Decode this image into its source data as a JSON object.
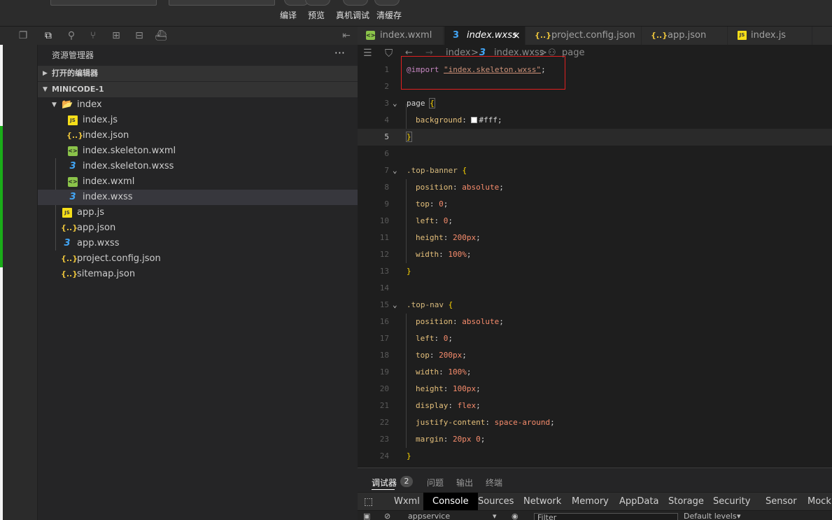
{
  "toolbar": {
    "compile": "编译",
    "preview": "预览",
    "device_debug": "真机调试",
    "clear_cache": "清缓存"
  },
  "activity_icons": [
    "window-icon",
    "files-icon",
    "search-icon",
    "git-branch-icon",
    "extensions-icon",
    "storage-icon",
    "docker-icon"
  ],
  "explorer": {
    "title": "资源管理器",
    "more": "···",
    "open_editors": "打开的编辑器",
    "project": "MINICODE-1",
    "tree": [
      {
        "label": "index",
        "type": "folder",
        "depth": 1
      },
      {
        "label": "index.js",
        "type": "js",
        "depth": 2
      },
      {
        "label": "index.json",
        "type": "json",
        "depth": 2
      },
      {
        "label": "index.skeleton.wxml",
        "type": "wxml",
        "depth": 2
      },
      {
        "label": "index.skeleton.wxss",
        "type": "wxss",
        "depth": 2
      },
      {
        "label": "index.wxml",
        "type": "wxml",
        "depth": 2
      },
      {
        "label": "index.wxss",
        "type": "wxss",
        "depth": 2,
        "selected": true
      },
      {
        "label": "app.js",
        "type": "js",
        "depth": 1
      },
      {
        "label": "app.json",
        "type": "json",
        "depth": 1
      },
      {
        "label": "app.wxss",
        "type": "wxss",
        "depth": 1
      },
      {
        "label": "project.config.json",
        "type": "json",
        "depth": 1
      },
      {
        "label": "sitemap.json",
        "type": "json",
        "depth": 1
      }
    ]
  },
  "tabs": [
    {
      "label": "index.wxml",
      "type": "wxml"
    },
    {
      "label": "index.wxss",
      "type": "wxss",
      "active": true,
      "close": "×"
    },
    {
      "label": "project.config.json",
      "type": "json"
    },
    {
      "label": "app.json",
      "type": "json"
    },
    {
      "label": "index.js",
      "type": "js"
    }
  ],
  "breadcrumb": {
    "folder": "index",
    "file": "index.wxss",
    "symbol": "page",
    "separator": ">"
  },
  "code": {
    "import_kw": "@import",
    "import_str": "\"index.skeleton.wxss\"",
    "lines": [
      {
        "n": "1"
      },
      {
        "n": "2"
      },
      {
        "n": "3"
      },
      {
        "n": "4"
      },
      {
        "n": "5"
      },
      {
        "n": "6"
      },
      {
        "n": "7"
      },
      {
        "n": "8"
      },
      {
        "n": "9"
      },
      {
        "n": "10"
      },
      {
        "n": "11"
      },
      {
        "n": "12"
      },
      {
        "n": "13"
      },
      {
        "n": "14"
      },
      {
        "n": "15"
      },
      {
        "n": "16"
      },
      {
        "n": "17"
      },
      {
        "n": "18"
      },
      {
        "n": "19"
      },
      {
        "n": "20"
      },
      {
        "n": "21"
      },
      {
        "n": "22"
      },
      {
        "n": "23"
      },
      {
        "n": "24"
      }
    ],
    "current_line": "5"
  },
  "panel": {
    "tabs": [
      "调试器",
      "问题",
      "输出",
      "终端"
    ],
    "problems_count": "2",
    "devtools_tabs": [
      "Wxml",
      "Console",
      "Sources",
      "Network",
      "Memory",
      "AppData",
      "Storage",
      "Security",
      "Sensor",
      "Mock"
    ],
    "active_devtools_tab": "Console",
    "context": "appservice",
    "filter_placeholder": "Filter",
    "levels": "Default levels"
  },
  "colors": {
    "accent_green": "#1aad19",
    "highlight_box": "#e02020",
    "editor_bg": "#1e1e1e"
  }
}
